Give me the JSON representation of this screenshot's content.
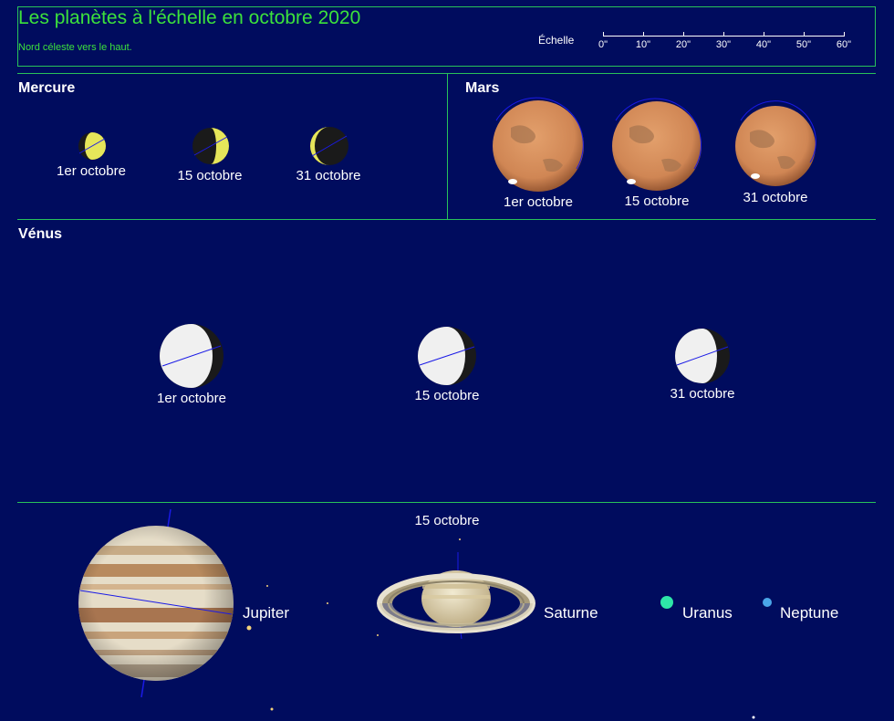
{
  "header": {
    "title": "Les planètes à l'échelle en octobre 2020",
    "subtitle": "Nord céleste vers le haut."
  },
  "scale": {
    "label": "Échelle",
    "ticks": [
      "0\"",
      "10\"",
      "20\"",
      "30\"",
      "40\"",
      "50\"",
      "60\""
    ]
  },
  "sections": {
    "mercury": "Mercure",
    "mars": "Mars",
    "venus": "Vénus",
    "outer_date": "15 octobre"
  },
  "dates": {
    "d1": "1er octobre",
    "d15": "15 octobre",
    "d31": "31 octobre"
  },
  "outer_planets": {
    "jupiter": "Jupiter",
    "saturn": "Saturne",
    "uranus": "Uranus",
    "neptune": "Neptune"
  },
  "colors": {
    "background": "#000c5e",
    "title_green": "#3ce13c",
    "divider_green": "#28c25a",
    "mercury": "#e6e65a",
    "venus": "#f0f0f0",
    "mars": "#d8915c",
    "uranus": "#2ee6a8",
    "neptune": "#4aa6e8",
    "axis_blue": "#1a1ae6"
  }
}
